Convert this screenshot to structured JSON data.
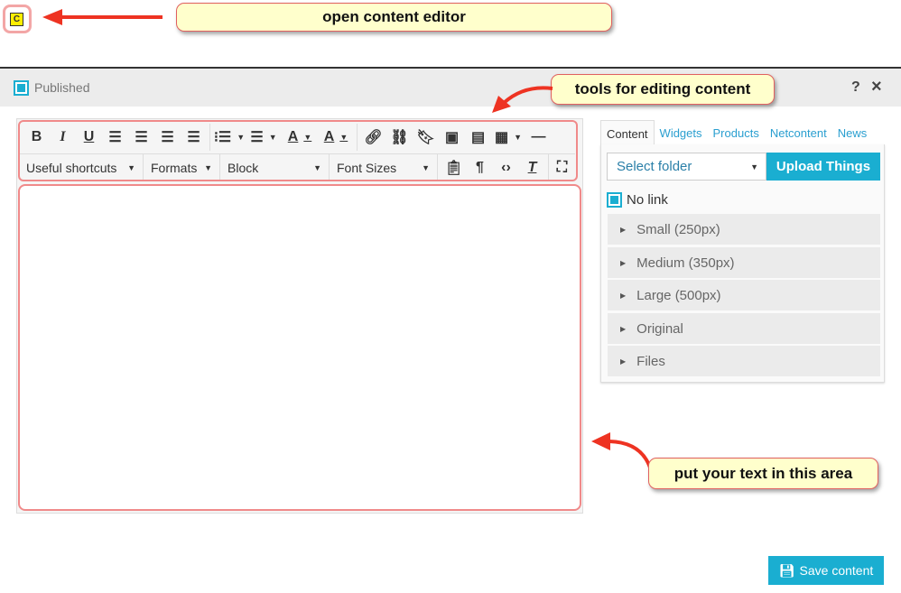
{
  "annotations": {
    "open_editor": "open content editor",
    "tools": "tools for editing content",
    "text_area": "put your text in this area"
  },
  "launcher": {
    "label": "C"
  },
  "header": {
    "published_label": "Published",
    "help": "?",
    "close": "×"
  },
  "toolbar": {
    "row1": [
      "bold-icon",
      "italic-icon",
      "underline-icon",
      "align-left-icon",
      "align-center-icon",
      "align-right-icon",
      "justify-icon",
      "bullet-list-icon",
      "numbered-list-icon",
      "text-color-icon",
      "background-color-icon",
      "link-icon",
      "unlink-icon",
      "bookmark-icon",
      "image-icon",
      "media-icon",
      "table-icon",
      "horizontal-rule-icon"
    ],
    "useful_shortcuts": "Useful shortcuts",
    "formats": "Formats",
    "block": "Block",
    "font_sizes": "Font Sizes",
    "row2_icons": [
      "paste-text-icon",
      "paragraph-icon",
      "source-code-icon",
      "clear-format-icon",
      "fullscreen-icon"
    ]
  },
  "panel": {
    "tabs": [
      "Content",
      "Widgets",
      "Products",
      "Netcontent",
      "News"
    ],
    "active_tab": "Content",
    "select_folder": "Select folder",
    "upload": "Upload Things",
    "no_link": "No link",
    "items": [
      "Small (250px)",
      "Medium (350px)",
      "Large (500px)",
      "Original",
      "Files"
    ]
  },
  "save": {
    "label": "Save content"
  },
  "colors": {
    "accent": "#1aaed1",
    "annotation_border": "#e06060",
    "annotation_bg": "#ffffcc"
  }
}
